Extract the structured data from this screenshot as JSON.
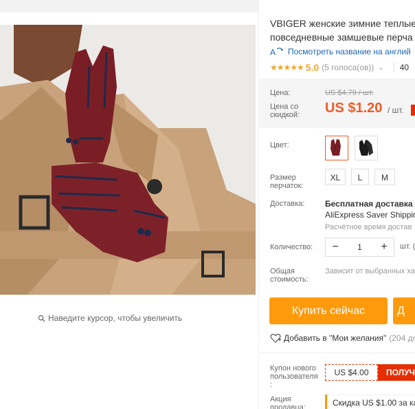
{
  "gallery": {
    "hover_hint": "Наведите курсор, чтобы увеличить"
  },
  "product": {
    "title_line1": "VBIGER женские зимние теплые",
    "title_line2": "повседневные замшевые перча",
    "translate_link": "Посмотреть название на англий",
    "rating": {
      "stars": "★★★★★",
      "score": "5.0",
      "votes": "(5 голоса(ов))",
      "orders": "40"
    }
  },
  "price": {
    "label": "Цена:",
    "old": "US $4.79 / шт.",
    "discount_label_1": "Цена со",
    "discount_label_2": "скидкой:",
    "current": "US $1.20",
    "unit": "/ шт."
  },
  "sku": {
    "color_label": "Цвет:",
    "colors": [
      "burgundy",
      "black"
    ],
    "size_label_1": "Размер",
    "size_label_2": "перчаток:",
    "sizes": [
      "XL",
      "L",
      "M"
    ]
  },
  "shipping": {
    "label": "Доставка:",
    "title": "Бесплатная доставка в",
    "service": "AliExpress Saver Shippin",
    "estimate": "Расчётное время достав"
  },
  "quantity": {
    "label": "Количество:",
    "value": "1",
    "minus": "−",
    "plus": "+",
    "unit": "шт. (1"
  },
  "total": {
    "label_1": "Общая",
    "label_2": "стоимость:",
    "note": "Зависит от выбранных хар"
  },
  "actions": {
    "buy_now": "Купить сейчас",
    "add_to_cart": "Д",
    "wishlist": "Добавить в \"Мои желания\"",
    "wishlist_count": "(204 до"
  },
  "coupon": {
    "label_1": "Купон нового",
    "label_2": "пользователя",
    "label_3": ":",
    "value": "US $4.00",
    "get": "ПОЛУЧ"
  },
  "promo": {
    "label_1": "Акция",
    "label_2": "продавца:",
    "text": "Скидка US $1.00 за ка"
  },
  "colors": {
    "accent_orange": "#ff9a0c",
    "price_red": "#f35a25",
    "coupon_red": "#e62e04",
    "link_blue": "#1a66b3",
    "star_gold": "#f5a623"
  }
}
